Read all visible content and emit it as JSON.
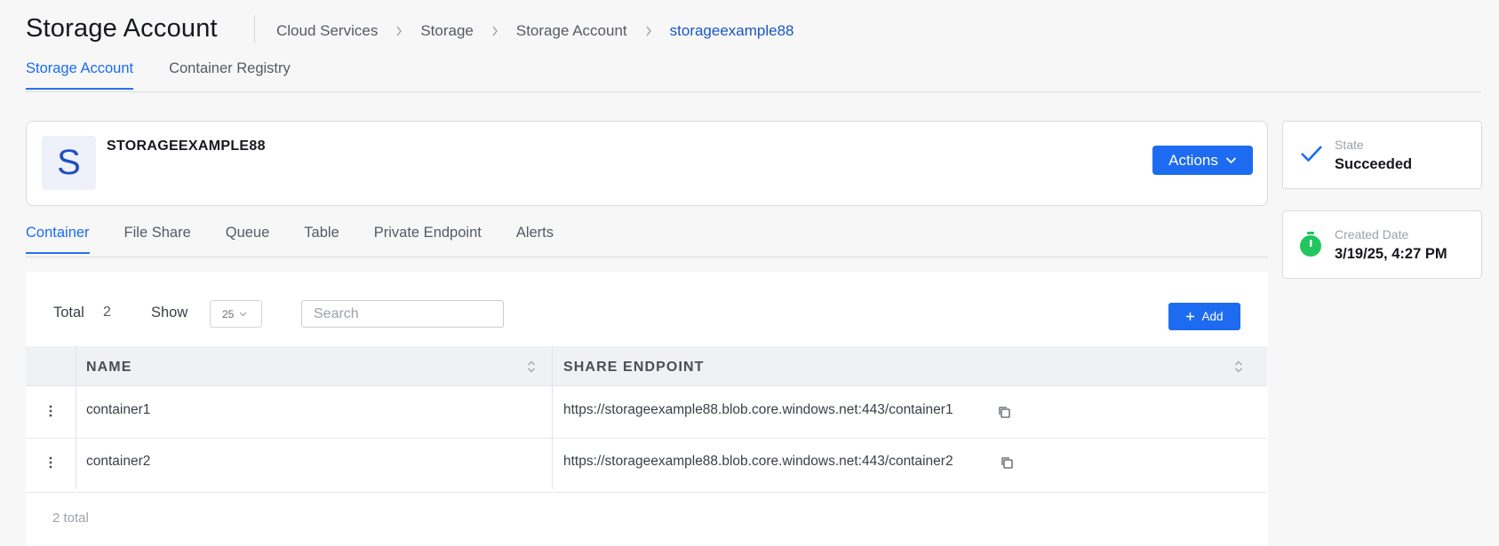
{
  "header": {
    "title": "Storage Account",
    "breadcrumb": [
      "Cloud Services",
      "Storage",
      "Storage Account",
      "storageexample88"
    ]
  },
  "top_tabs": [
    {
      "label": "Storage Account",
      "active": true
    },
    {
      "label": "Container Registry",
      "active": false
    }
  ],
  "resource": {
    "avatar_letter": "S",
    "name": "STORAGEEXAMPLE88",
    "actions_label": "Actions"
  },
  "status": {
    "state_label": "State",
    "state_value": "Succeeded",
    "created_label": "Created Date",
    "created_value": "3/19/25, 4:27 PM"
  },
  "sub_tabs": [
    {
      "label": "Container",
      "active": true
    },
    {
      "label": "File Share",
      "active": false
    },
    {
      "label": "Queue",
      "active": false
    },
    {
      "label": "Table",
      "active": false
    },
    {
      "label": "Private Endpoint",
      "active": false
    },
    {
      "label": "Alerts",
      "active": false
    }
  ],
  "toolbar": {
    "total_label": "Total",
    "total_count": "2",
    "show_label": "Show",
    "page_size": "25",
    "search_placeholder": "Search",
    "add_label": "Add"
  },
  "table": {
    "columns": [
      "NAME",
      "SHARE ENDPOINT"
    ],
    "rows": [
      {
        "name": "container1",
        "endpoint": "https://storageexample88.blob.core.windows.net:443/container1"
      },
      {
        "name": "container2",
        "endpoint": "https://storageexample88.blob.core.windows.net:443/container2"
      }
    ],
    "footer": "2 total"
  },
  "icons": {
    "state": "check-icon",
    "created": "stopwatch-icon",
    "copy": "copy-icon",
    "row_menu": "kebab-icon",
    "sort": "sort-icon",
    "actions_caret": "chevron-down-icon",
    "add": "plus-icon"
  },
  "colors": {
    "accent": "#1d6bf0",
    "active_tab": "#1a6cf0",
    "success_check": "#1a6cf0",
    "created_icon": "#22c55e"
  }
}
